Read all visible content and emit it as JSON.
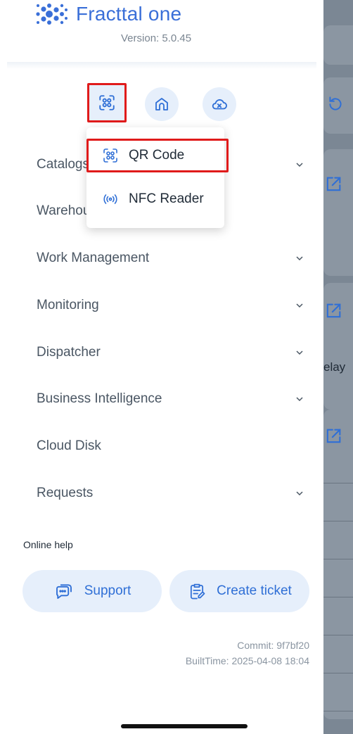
{
  "header": {
    "app_name": "Fracttal one",
    "version": "Version: 5.0.45"
  },
  "top_actions": [
    {
      "name": "scan",
      "icon": "scan-icon"
    },
    {
      "name": "home",
      "icon": "home-icon"
    },
    {
      "name": "cloud-off",
      "icon": "cloud-off-icon"
    }
  ],
  "scan_menu": {
    "items": [
      {
        "label": "QR Code",
        "icon": "qr-code-icon"
      },
      {
        "label": "NFC Reader",
        "icon": "nfc-icon"
      }
    ]
  },
  "menu": {
    "items": [
      {
        "label": "Catalogs",
        "has_chevron": true
      },
      {
        "label": "Warehouse",
        "has_chevron": false
      },
      {
        "label": "Work Management",
        "has_chevron": true
      },
      {
        "label": "Monitoring",
        "has_chevron": true
      },
      {
        "label": "Dispatcher",
        "has_chevron": true
      },
      {
        "label": "Business Intelligence",
        "has_chevron": true
      },
      {
        "label": "Cloud Disk",
        "has_chevron": false
      },
      {
        "label": "Requests",
        "has_chevron": true
      }
    ]
  },
  "help": {
    "title": "Online help",
    "support_label": "Support",
    "ticket_label": "Create ticket"
  },
  "build": {
    "commit": "Commit: 9f7bf20",
    "built_time": "BuiltTime: 2025-04-08 18:04"
  },
  "background": {
    "partial_text": "elay"
  },
  "colors": {
    "accent": "#2f6fd6",
    "highlight_border": "#e01b1b",
    "button_bg": "#e6effb"
  }
}
